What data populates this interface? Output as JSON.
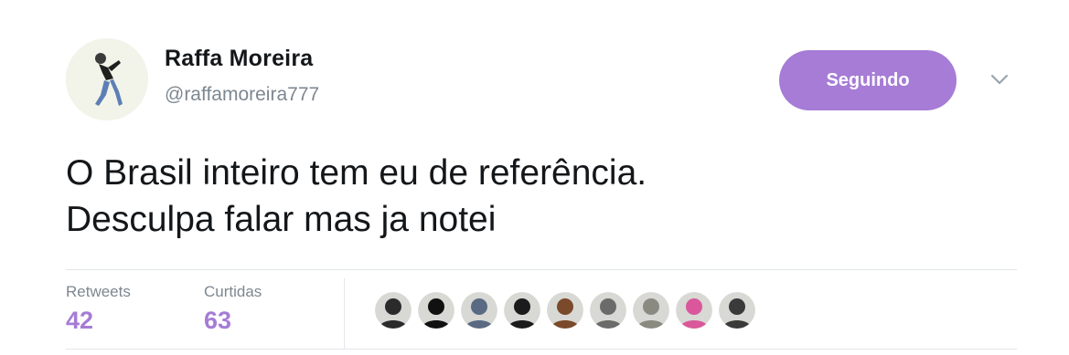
{
  "colors": {
    "accent": "#a67cd6",
    "text": "#14171a",
    "muted": "#7d8790",
    "divider": "#e3e6e9"
  },
  "author": {
    "name": "Raffa Moreira",
    "handle": "@raffamoreira777"
  },
  "follow_button": {
    "label": "Seguindo"
  },
  "menu": {
    "icon": "chevron-down-icon"
  },
  "tweet": {
    "lines": [
      "O Brasil inteiro tem eu de referência.",
      "Desculpa falar mas ja notei"
    ]
  },
  "stats": {
    "retweets_label": "Retweets",
    "retweets_value": "42",
    "likes_label": "Curtidas",
    "likes_value": "63"
  },
  "likers": [
    {
      "icon": "user-avatar-icon",
      "color": "#2b2b2b"
    },
    {
      "icon": "user-avatar-icon",
      "color": "#111111"
    },
    {
      "icon": "user-avatar-icon",
      "color": "#5a6a82"
    },
    {
      "icon": "user-avatar-icon",
      "color": "#1b1b1b"
    },
    {
      "icon": "user-avatar-icon",
      "color": "#7a4a2a"
    },
    {
      "icon": "user-avatar-icon",
      "color": "#6b6b6b"
    },
    {
      "icon": "user-avatar-icon",
      "color": "#8a8a80"
    },
    {
      "icon": "user-avatar-icon",
      "color": "#d9579a"
    },
    {
      "icon": "user-avatar-icon",
      "color": "#3a3a3a"
    }
  ]
}
